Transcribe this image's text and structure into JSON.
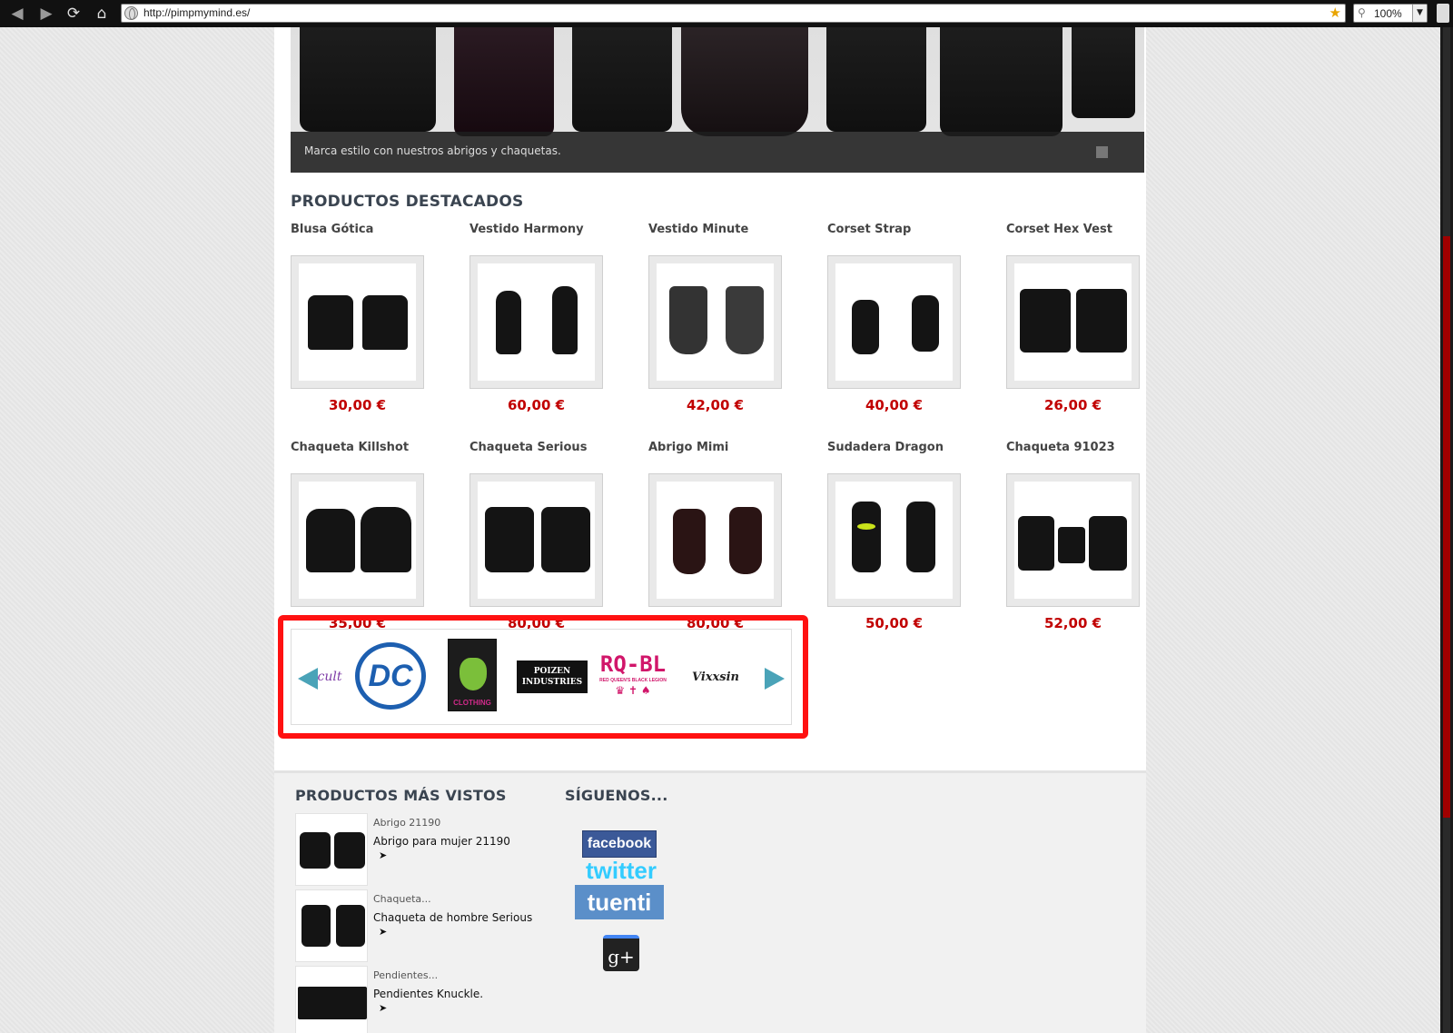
{
  "browser": {
    "url": "http://pimpmymind.es/",
    "zoom": "100%",
    "star_color": "#e9a400"
  },
  "hero": {
    "caption": "Marca estilo con nuestros abrigos y chaquetas."
  },
  "featured": {
    "title": "PRODUCTOS DESTACADOS",
    "products": [
      {
        "name": "Blusa Gótica",
        "price": "30,00 €"
      },
      {
        "name": "Vestido Harmony",
        "price": "60,00 €"
      },
      {
        "name": "Vestido Minute",
        "price": "42,00 €"
      },
      {
        "name": "Corset Strap",
        "price": "40,00 €"
      },
      {
        "name": "Corset Hex Vest",
        "price": "26,00 €"
      },
      {
        "name": "Chaqueta Killshot",
        "price": "35,00 €"
      },
      {
        "name": "Chaqueta Serious",
        "price": "80,00 €"
      },
      {
        "name": "Abrigo Mimi",
        "price": "80,00 €"
      },
      {
        "name": "Sudadera Dragon",
        "price": "50,00 €"
      },
      {
        "name": "Chaqueta 91023",
        "price": "52,00 €"
      }
    ],
    "price_color": "#c10000"
  },
  "brands": {
    "highlight_color": "#ff1111",
    "items": [
      {
        "icon": "cult-logo",
        "text": "cult"
      },
      {
        "icon": "dc-logo",
        "text": "DC"
      },
      {
        "icon": "heartless-clothing-logo",
        "text": "CLOTHING"
      },
      {
        "icon": "poizen-industries-logo",
        "text": "POIZEN INDUSTRIES"
      },
      {
        "icon": "rq-bl-logo",
        "text": "RQ-BL",
        "subtext": "RED QUEEN'S BLACK LEGION"
      },
      {
        "icon": "vixxsin-logo",
        "text": "Vixxsin"
      }
    ]
  },
  "most_viewed": {
    "title": "PRODUCTOS MÁS VISTOS",
    "items": [
      {
        "category": "Abrigo 21190",
        "name": "Abrigo para mujer 21190"
      },
      {
        "category": "Chaqueta...",
        "name": "Chaqueta de hombre Serious"
      },
      {
        "category": "Pendientes...",
        "name": "Pendientes Knuckle."
      }
    ]
  },
  "follow": {
    "title": "SÍGUENOS...",
    "networks": [
      {
        "icon": "facebook-logo",
        "label": "facebook",
        "color": "#3b5998"
      },
      {
        "icon": "twitter-logo",
        "label": "twitter",
        "color": "#33ccff"
      },
      {
        "icon": "tuenti-logo",
        "label": "tuenti",
        "color": "#5b8fc9"
      },
      {
        "icon": "google-plus-logo",
        "label": "g+",
        "color": "#222222"
      }
    ]
  }
}
